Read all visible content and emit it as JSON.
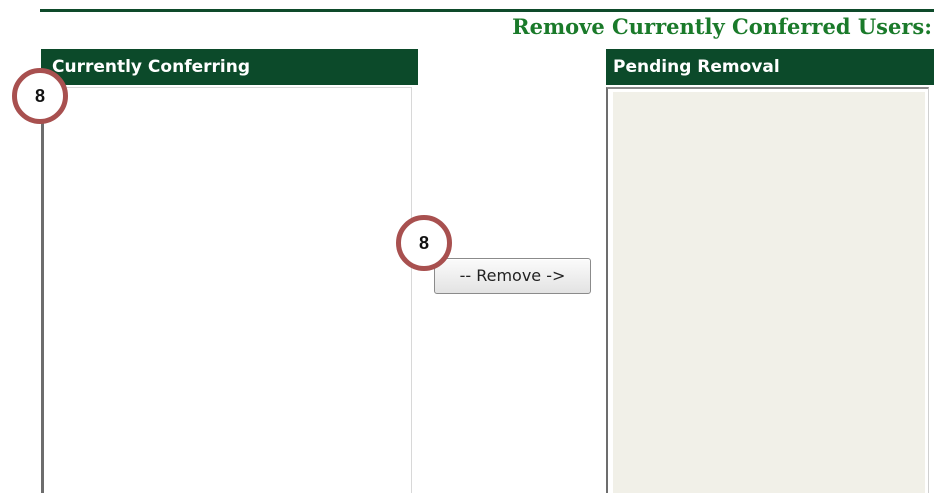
{
  "section": {
    "title": "Remove Currently Conferred Users:"
  },
  "left_panel": {
    "header": "Currently Conferring",
    "items": []
  },
  "right_panel": {
    "header": "Pending Removal",
    "items": []
  },
  "actions": {
    "remove_label": "-- Remove ->"
  },
  "callouts": {
    "first": "8",
    "second": "8"
  },
  "colors": {
    "header_bg": "#0c4a2a",
    "title_green": "#1a7a2a",
    "pending_bg": "#f1f0e8",
    "callout_ring": "#a8504f"
  }
}
